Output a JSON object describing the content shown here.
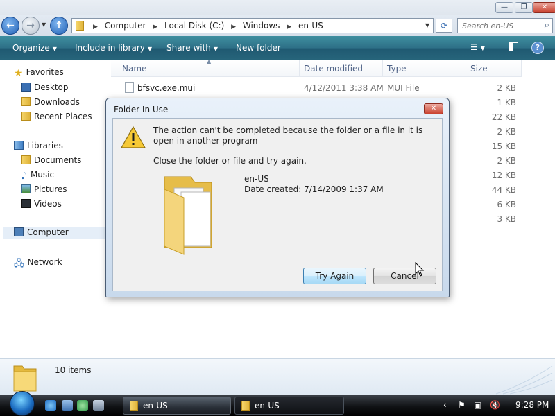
{
  "window": {
    "controls": {
      "minimize": "—",
      "maximize": "❐",
      "close": "✕"
    }
  },
  "address_bar": {
    "breadcrumbs": [
      "Computer",
      "Local Disk (C:)",
      "Windows",
      "en-US"
    ],
    "search_placeholder": "Search en-US"
  },
  "toolbar": {
    "organize": "Organize",
    "include_in_library": "Include in library",
    "share_with": "Share with",
    "new_folder": "New folder"
  },
  "nav_pane": {
    "favorites_header": "Favorites",
    "favorites": [
      "Desktop",
      "Downloads",
      "Recent Places"
    ],
    "libraries_header": "Libraries",
    "libraries": [
      "Documents",
      "Music",
      "Pictures",
      "Videos"
    ],
    "computer": "Computer",
    "network": "Network"
  },
  "file_list": {
    "columns": [
      "Name",
      "Date modified",
      "Type",
      "Size"
    ],
    "rows": [
      {
        "name": "bfsvc.exe.mui",
        "date": "4/12/2011 3:38 AM",
        "type": "MUI File",
        "size": "2 KB"
      },
      {
        "size": "1 KB"
      },
      {
        "size": "22 KB"
      },
      {
        "size": "2 KB"
      },
      {
        "size": "15 KB"
      },
      {
        "size": "2 KB"
      },
      {
        "size": "12 KB"
      },
      {
        "size": "44 KB"
      },
      {
        "size": "6 KB"
      },
      {
        "size": "3 KB"
      }
    ]
  },
  "details_pane": {
    "item_count": "10 items"
  },
  "dialog": {
    "title": "Folder In Use",
    "message": "The action can't be completed because the folder or a file in it is open in another program",
    "instruction": "Close the folder or file and try again.",
    "folder_name": "en-US",
    "date_created": "Date created: 7/14/2009 1:37 AM",
    "try_again": "Try Again",
    "cancel": "Cancel"
  },
  "taskbar": {
    "buttons": [
      "en-US",
      "en-US"
    ],
    "clock": "9:28 PM"
  },
  "colors": {
    "toolbar": "#2d6f86",
    "taskbar": "#101215",
    "dialog_frame": "#c8d9ec"
  }
}
